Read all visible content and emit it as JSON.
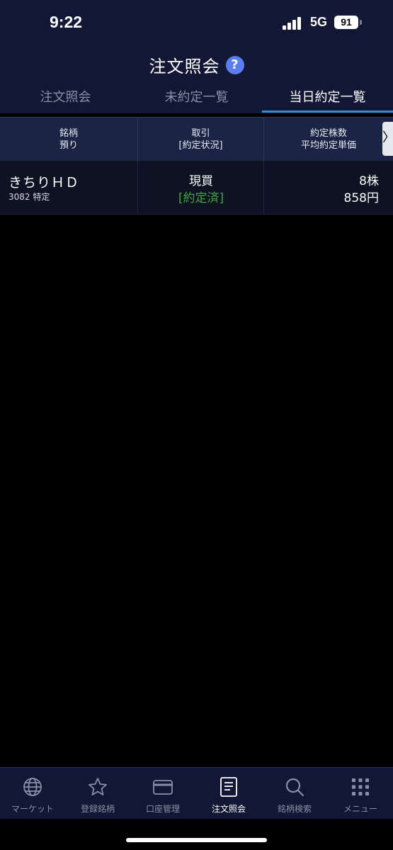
{
  "status_bar": {
    "time": "9:22",
    "network": "5G",
    "battery": "91"
  },
  "header": {
    "title": "注文照会",
    "help_icon": "question-icon",
    "help_glyph": "?"
  },
  "tabs": [
    {
      "label": "注文照会",
      "active": false
    },
    {
      "label": "未約定一覧",
      "active": false
    },
    {
      "label": "当日約定一覧",
      "active": true
    }
  ],
  "table": {
    "columns": [
      {
        "line1": "銘柄",
        "line2": "預り"
      },
      {
        "line1": "取引",
        "line2": "[約定状況]"
      },
      {
        "line1": "約定株数",
        "line2": "平均約定単価"
      }
    ],
    "scroll_glyph": "〉",
    "rows": [
      {
        "name": "きちりＨＤ",
        "sub": "3082 特定",
        "trade": "現買",
        "status": "[約定済]",
        "quantity": "8株",
        "price": "858円"
      }
    ]
  },
  "colors": {
    "accent": "#2f8fd8",
    "status_filled": "#3ea63e",
    "header_bg": "#111735"
  },
  "bottom_nav": [
    {
      "label": "マーケット",
      "icon": "globe-icon",
      "active": false
    },
    {
      "label": "登録銘柄",
      "icon": "star-icon",
      "active": false
    },
    {
      "label": "口座管理",
      "icon": "card-icon",
      "active": false
    },
    {
      "label": "注文照会",
      "icon": "document-icon",
      "active": true
    },
    {
      "label": "銘柄検索",
      "icon": "search-icon",
      "active": false
    },
    {
      "label": "メニュー",
      "icon": "grid-menu-icon",
      "active": false
    }
  ]
}
